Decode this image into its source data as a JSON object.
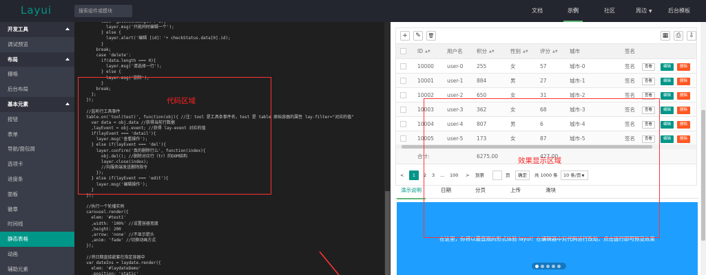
{
  "topbar": {
    "logo": "Layui",
    "search_placeholder": "搜索组件或模块",
    "nav": [
      "文档",
      "示例",
      "社区",
      "周边",
      "后台模板"
    ],
    "active_nav": "示例"
  },
  "sidebar": {
    "items": [
      {
        "label": "开发工具",
        "group": true
      },
      {
        "label": "调试预览",
        "group": false
      },
      {
        "label": "布局",
        "group": true
      },
      {
        "label": "栅格",
        "group": false
      },
      {
        "label": "后台布局",
        "group": false
      },
      {
        "label": "基本元素",
        "group": true
      },
      {
        "label": "按钮",
        "group": false
      },
      {
        "label": "表单",
        "group": false
      },
      {
        "label": "导航/面包屑",
        "group": false
      },
      {
        "label": "选项卡",
        "group": false
      },
      {
        "label": "进度条",
        "group": false
      },
      {
        "label": "面板",
        "group": false
      },
      {
        "label": "徽章",
        "group": false
      },
      {
        "label": "时间线",
        "group": false
      },
      {
        "label": "静态表格",
        "group": false
      },
      {
        "label": "动画",
        "group": false
      },
      {
        "label": "辅助元素",
        "group": false
      }
    ]
  },
  "code": {
    "lines": [
      "        case 'getCheckLength': 1){",
      "          layer.msg('只能同时编辑一个');",
      "        } else {",
      "          layer.alert('编辑 [id]：'+ checkStatus.data[0].id);",
      "        }",
      "      break;",
      "      case 'delete':",
      "        if(data.length === 0){",
      "          layer.msg('请选择一行');",
      "        } else {",
      "          layer.msg('删除');",
      "        }",
      "      break;",
      "    };",
      "  });",
      "",
      "  //监听行工具事件",
      "  table.on('tool(test)', function(obj){ //注：tool 是工具条事件名，test 是 table 原始容器的属性 lay-filter=\"对应的值\"",
      "    var data = obj.data //获得当前行数据",
      "    ,layEvent = obj.event; //获得 lay-event 对应的值",
      "    if(layEvent === 'detail'){",
      "      layer.msg('查看操作');",
      "    } else if(layEvent === 'del'){",
      "      layer.confirm('真的删除行么', function(index){",
      "        obj.del(); //删除对应行（tr）的DOM结构",
      "        layer.close(index);",
      "        //向服务端发送删除指令",
      "      });",
      "    } else if(layEvent === 'edit'){",
      "      layer.msg('编辑操作');",
      "    }",
      "  });",
      "",
      "  //执行一个轮播实例",
      "  carousel.render({",
      "    elem: '#test1'",
      "    ,width: '100%' //设置容器宽度",
      "    ,height: 200",
      "    ,arrow: 'none' //不显示箭头",
      "    ,anim: 'fade' //切换动画方式",
      "  });",
      "",
      "  //将日期直接嵌套在指定容器中",
      "  var dateIns = laydate.render({",
      "    elem: '#laydateDemo'",
      "    ,position: 'static'"
    ]
  },
  "annotations": {
    "code_area": "代码区域",
    "effect_area": "效果显示区域",
    "color": "#ff3333"
  },
  "table": {
    "toolbar_left": [
      "+",
      "✎",
      "🗑"
    ],
    "toolbar_right": [
      "▦",
      "⎙",
      "⇩"
    ],
    "columns": [
      "ID",
      "用户名",
      "积分",
      "性别",
      "评分",
      "城市",
      "签名"
    ],
    "rows": [
      {
        "id": "10000",
        "user": "user-0",
        "score": "255",
        "sex": "女",
        "rate": "57",
        "city": "城市-0",
        "sign": "签名"
      },
      {
        "id": "10001",
        "user": "user-1",
        "score": "884",
        "sex": "男",
        "rate": "27",
        "city": "城市-1",
        "sign": "签名"
      },
      {
        "id": "10002",
        "user": "user-2",
        "score": "650",
        "sex": "女",
        "rate": "31",
        "city": "城市-2",
        "sign": "签名"
      },
      {
        "id": "10003",
        "user": "user-3",
        "score": "362",
        "sex": "女",
        "rate": "68",
        "city": "城市-3",
        "sign": "签名"
      },
      {
        "id": "10004",
        "user": "user-4",
        "score": "807",
        "sex": "男",
        "rate": "6",
        "city": "城市-4",
        "sign": "签名"
      },
      {
        "id": "10005",
        "user": "user-5",
        "score": "173",
        "sex": "女",
        "rate": "87",
        "city": "城市-5",
        "sign": "签名"
      }
    ],
    "ops": {
      "view": "查看",
      "edit": "编辑",
      "del": "删除"
    },
    "total_label": "合计:",
    "total_score": "6275.00",
    "total_rate": "427.00"
  },
  "pager": {
    "prev": "<",
    "current": "1",
    "p2": "2",
    "p3": "3",
    "ellipsis": "...",
    "last": "100",
    "next": ">",
    "goto_label": "到第",
    "page_label": "页",
    "confirm": "确定",
    "total": "共 1000 条",
    "per_page": "10 条/页"
  },
  "tabs": {
    "items": [
      "演示说明",
      "日期",
      "分页",
      "上传",
      "滑块"
    ],
    "active": "演示说明"
  },
  "carousel": {
    "text": "在这里，你将以最直观的形式体验 layui！在编辑器中对代码进行改动，点击运行即可预览效果",
    "dots": 5,
    "active_dot": 0
  },
  "colors": {
    "topbar": "#23262e",
    "sidebar": "#393d49",
    "accent": "#009688",
    "danger": "#ff5722",
    "carousel": "#1e9fff"
  }
}
